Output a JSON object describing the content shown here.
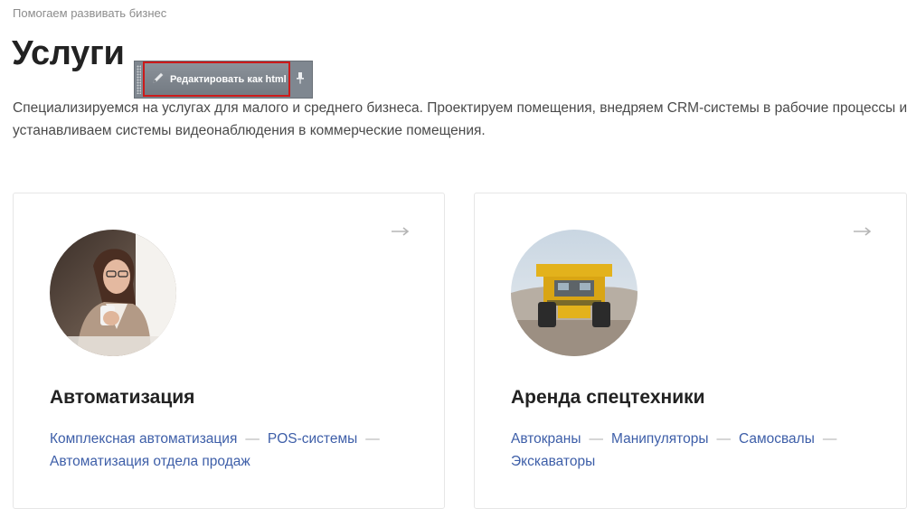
{
  "breadcrumb": "Помогаем развивать бизнес",
  "page": {
    "title": "Услуги",
    "intro": "Специализируемся на услугах для малого и среднего бизнеса. Проектируем помещения, внедряем CRM-системы в рабочие процессы и устанавливаем системы видеонаблюдения в коммерческие помещения."
  },
  "editor_toolbar": {
    "edit_html_label": "Редактировать как html",
    "pin_icon": "pin-icon",
    "edit_icon": "pencil-icon"
  },
  "cards": [
    {
      "title": "Автоматизация",
      "image": "woman-with-coffee-photo",
      "arrow_icon": "arrow-right-icon",
      "links": [
        "Комплексная автоматизация",
        "POS-системы",
        "Автоматизация отдела продаж"
      ],
      "separator": "—"
    },
    {
      "title": "Аренда спецтехники",
      "image": "mining-dump-truck-photo",
      "arrow_icon": "arrow-right-icon",
      "links": [
        "Автокраны",
        "Манипуляторы",
        "Самосвалы",
        "Экскаваторы"
      ],
      "separator": "—"
    }
  ],
  "colors": {
    "link": "#3d5ea8",
    "title": "#222222",
    "text": "#4a4a4a",
    "muted": "#8c8c8c",
    "toolbar": "#7f8790",
    "highlight_border": "#cc1a1a"
  }
}
